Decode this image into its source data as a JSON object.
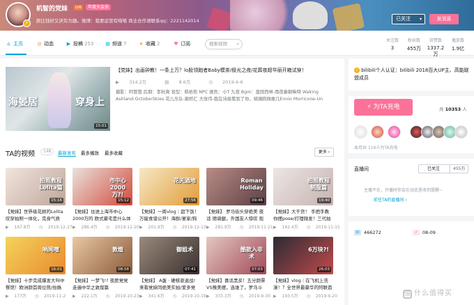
{
  "header": {
    "username": "机智的党妹",
    "level": "LV6",
    "vip_label": "年度大会员",
    "signature": "颜比钱好又厌有为趣。微博：我要运营有喵喵 商业合作语联系qq：2221142014",
    "followed_button": "已关注",
    "message_button": "发消息"
  },
  "nav": {
    "items": [
      {
        "label": "主页",
        "icon": "home-icon",
        "count": ""
      },
      {
        "label": "动态",
        "icon": "dynamic-icon",
        "count": ""
      },
      {
        "label": "投稿",
        "icon": "upload-icon",
        "count": "253"
      },
      {
        "label": "频道",
        "icon": "channel-icon",
        "count": "7"
      },
      {
        "label": "收藏",
        "icon": "favorite-icon",
        "count": "2"
      },
      {
        "label": "订阅",
        "icon": "subscribe-icon",
        "count": ""
      }
    ],
    "search_placeholder": "搜索视频",
    "stats": [
      {
        "label": "关注数",
        "value": "3"
      },
      {
        "label": "粉丝数",
        "value": "455万"
      },
      {
        "label": "获赞数",
        "value": "1337.2万"
      },
      {
        "label": "播放数",
        "value": "1.9亿"
      }
    ]
  },
  "top_video": {
    "thumb_text_left": "海晏居",
    "thumb_text_right": "穿身上",
    "duration": "15:01",
    "title": "【党妹】出画钟教！一条上万？lo股领跑者Baby模茶/极光之夜/花葬夜超华丽开箱试穿！",
    "plays": "314.2万",
    "comments": "8.6万",
    "date": "2019-6-6",
    "desc_line1": "摄影：阿管管 后期：李秋爽 妆型：韩依熊 NPC 画色：小T 九夜 Bgm：盘园西林-雨夜秦朝嘛特 Waking",
    "desc_line2": "Ashland-OctoberSkies 花儿乐队-颞桥汇 大张伟-我在诗眉看到了你，胡瀚鸥佩敢几Ennio Morricone-Un"
  },
  "videos_section": {
    "title": "TA的视频",
    "count": "148",
    "sort_latest": "最新发布",
    "sort_most_played": "最多播放",
    "sort_most_fav": "最多收藏",
    "more": "更多"
  },
  "videos": [
    {
      "title": "【党妹】世界级花顾的Lolita 叹穿拍照一体化，完身气质",
      "duration": "15:16",
      "plays": "167.8万",
      "date": "2019-12-27",
      "tag": "拍照教程Lolita篇",
      "c1": "#f1e5de",
      "c2": "#bfa59a"
    },
    {
      "title": "【党妹】住进上海市中心 2000万的 欧式豪宅是什么体验",
      "duration": "15:12",
      "plays": "286.4万",
      "date": "2019-12-20",
      "tag": "市中心2000万?!",
      "c1": "#e8e2dc",
      "c2": "#d44a3c"
    },
    {
      "title": "【党妹】一周vlog｜超下饭！ 万能食谱公开！海鲜/宴家/狗",
      "duration": "27:56",
      "plays": "201.9万",
      "date": "2019-12-13",
      "tag": "花天酒地",
      "c1": "#f6e8c6",
      "c2": "#e29c3a"
    },
    {
      "title": "【党妹】 罗马街头穿绝美 夜话 德骑腿，外国友人惊叹 现场",
      "duration": "09:46",
      "plays": "281.9万",
      "date": "2019-11-21",
      "tag": "Roman Holiday",
      "c1": "#b98c86",
      "c2": "#5d3f44"
    },
    {
      "title": "【党妹】大干货！ 手把手教你摆pose/打理微发！三代拍照",
      "duration": "19:40",
      "plays": "142.4万",
      "date": "2019-11-15",
      "tag": "拍照教程制服篇",
      "c1": "#ece6e3",
      "c2": "#c7b2b1"
    },
    {
      "title": "【党妹】十步完成爆发大叫中餐馆！欧洲颜首周位熊/抬胳膊",
      "duration": "16:01",
      "plays": "177万",
      "date": "2019-11-2",
      "tag": "呐闻喧",
      "c1": "#f4d35b",
      "c2": "#e98a2f"
    },
    {
      "title": "【党妹】一梦飞!? 夜愿党党走遍中华之敦煌篇",
      "duration": "08:58",
      "plays": "222.1万",
      "date": "2019-10-23",
      "tag": "敦煌",
      "c1": "#e9c8a4",
      "c2": "#8a5a3a"
    },
    {
      "title": "【党妹】 A蛋 · 硬核驱退战! 来看党妹同绝美实拍/爱多党",
      "duration": "07:41",
      "plays": "341.6万",
      "date": "2019-10-19",
      "tag": "御姐术",
      "c1": "#9a8a7c",
      "c2": "#3a3030"
    },
    {
      "title": "【党妹】喜话黑买！五分颜票VS豫美摆，选谁了，罗马斗兽",
      "duration": "07:03",
      "plays": "333.3万",
      "date": "2019-9-30",
      "tag": "酷款入非术",
      "c1": "#e4c7c0",
      "c2": "#a24a58"
    },
    {
      "title": "【党妹】vlog｜在飞机上洗澡！？全世界最豪华的阿联酋",
      "duration": "26:03",
      "plays": "193.5万",
      "date": "2019-9-20",
      "tag": "6万块?!",
      "c1": "#2b2b35",
      "c2": "#c24a4a"
    }
  ],
  "side": {
    "verify_text": "bilibili个人认证：bilibili 2018百大UP主、高能联盟成员",
    "charge_button": "为TA充电",
    "charge_total_prefix": "共",
    "charge_total": "10353",
    "charge_total_suffix": "人",
    "month_note": "本月共 116人为TA充电",
    "live_title": "直播间",
    "live_followed": "已关注",
    "live_fans": "455万",
    "live_msg": "主播不在，开播时你会在动态里收到提醒~",
    "live_link": "前往TA的直播间",
    "uid": "466272",
    "birthday": "08-09"
  },
  "watermark": "什么值得买",
  "colors": {
    "accent_blue": "#00a1d6",
    "brand_pink": "#fb7299"
  }
}
